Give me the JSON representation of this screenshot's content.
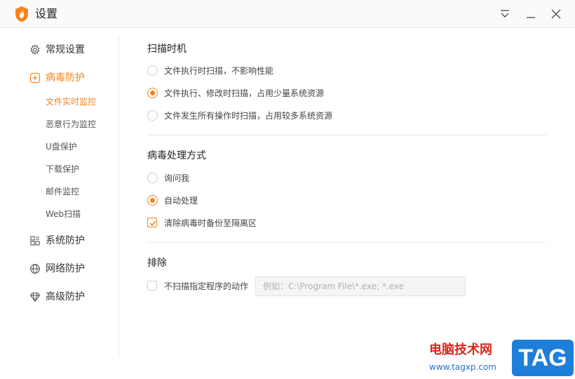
{
  "window": {
    "title": "设置",
    "icons": {
      "logo": "flame-shield-icon",
      "menu": "menu-dropdown-icon",
      "minimize": "minimize-icon",
      "close": "close-icon"
    }
  },
  "colors": {
    "accent": "#f5841f",
    "text": "#333333",
    "divider": "#ebebeb"
  },
  "sidebar": {
    "groups": [
      {
        "label": "常规设置",
        "icon": "gear-icon"
      },
      {
        "label": "病毒防护",
        "icon": "plus-shield-icon",
        "active": true
      },
      {
        "label": "系统防护",
        "icon": "system-grid-icon"
      },
      {
        "label": "网络防护",
        "icon": "globe-icon"
      },
      {
        "label": "高级防护",
        "icon": "diamond-icon"
      }
    ],
    "subitems": [
      {
        "label": "文件实时监控",
        "active": true
      },
      {
        "label": "恶意行为监控"
      },
      {
        "label": "U盘保护"
      },
      {
        "label": "下载保护"
      },
      {
        "label": "邮件监控"
      },
      {
        "label": "Web扫描"
      }
    ]
  },
  "main": {
    "scan_timing": {
      "title": "扫描时机",
      "options": [
        {
          "label": "文件执行时扫描，不影响性能",
          "checked": false
        },
        {
          "label": "文件执行、修改时扫描，占用少量系统资源",
          "checked": true
        },
        {
          "label": "文件发生所有操作时扫描，占用较多系统资源",
          "checked": false
        }
      ]
    },
    "virus_handling": {
      "title": "病毒处理方式",
      "options": [
        {
          "label": "询问我",
          "checked": false
        },
        {
          "label": "自动处理",
          "checked": true
        }
      ],
      "backup_checkbox": {
        "label": "清除病毒时备份至隔离区",
        "checked": true
      }
    },
    "exclude": {
      "title": "排除",
      "checkbox": {
        "label": "不扫描指定程序的动作",
        "checked": false
      },
      "input_placeholder": "例如：C:\\Program File\\*.exe; *.exe",
      "input_value": ""
    }
  },
  "watermark": {
    "line1": "电脑技术网",
    "line2": "www.tagxp.com",
    "badge": "TAG"
  }
}
